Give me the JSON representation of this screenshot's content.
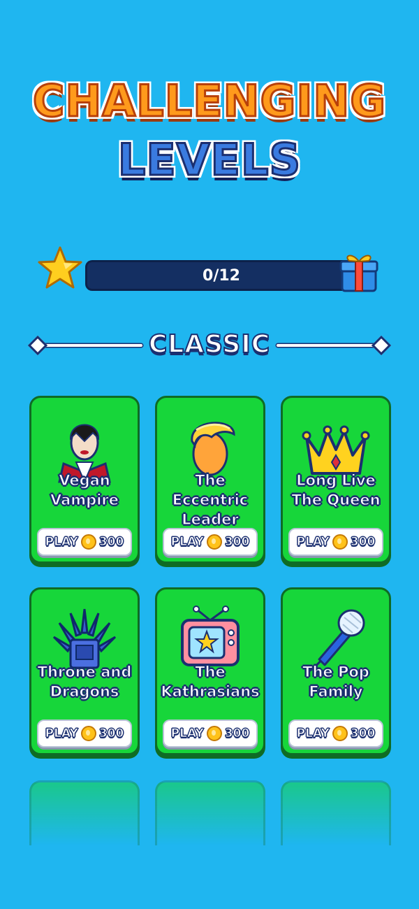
{
  "header": {
    "title_line1": "CHALLENGING",
    "title_line2": "LEVELS"
  },
  "progress": {
    "text": "0/12",
    "completed": 0,
    "total": 12,
    "fill_color": "#ffc829",
    "track_color": "#142f62"
  },
  "section": {
    "title": "CLASSIC"
  },
  "levels": [
    {
      "title": "Vegan\nVampire",
      "play_label": "PLAY",
      "price": "300",
      "icon": "vampire-icon"
    },
    {
      "title": "The Eccentric\nLeader",
      "play_label": "PLAY",
      "price": "300",
      "icon": "blonde-hair-man-icon"
    },
    {
      "title": "Long Live\nThe Queen",
      "play_label": "PLAY",
      "price": "300",
      "icon": "crown-icon"
    },
    {
      "title": "Throne and\nDragons",
      "play_label": "PLAY",
      "price": "300",
      "icon": "iron-throne-icon"
    },
    {
      "title": "The\nKathrasians",
      "play_label": "PLAY",
      "price": "300",
      "icon": "tv-icon"
    },
    {
      "title": "The Pop\nFamily",
      "play_label": "PLAY",
      "price": "300",
      "icon": "microphone-icon"
    }
  ],
  "colors": {
    "background": "#1fb6f0",
    "card": "#17d63a",
    "card_border": "#0f6b25",
    "text_outline": "#1b2f70"
  }
}
